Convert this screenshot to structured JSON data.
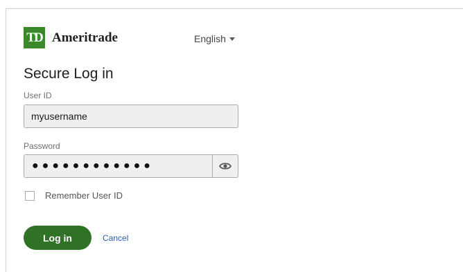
{
  "brand": {
    "mark": "TD",
    "name": "Ameritrade",
    "color": "#3b8a2a"
  },
  "language": {
    "selected": "English"
  },
  "form": {
    "title": "Secure Log in",
    "user_label": "User ID",
    "user_value": "myusername",
    "password_label": "Password",
    "password_masked": "●●●●●●●●●●●●",
    "show_password_icon": "eye-icon",
    "remember_label": "Remember User ID",
    "remember_checked": false
  },
  "actions": {
    "login_label": "Log in",
    "cancel_label": "Cancel",
    "login_color": "#2f7226",
    "cancel_color": "#2a5db0"
  }
}
